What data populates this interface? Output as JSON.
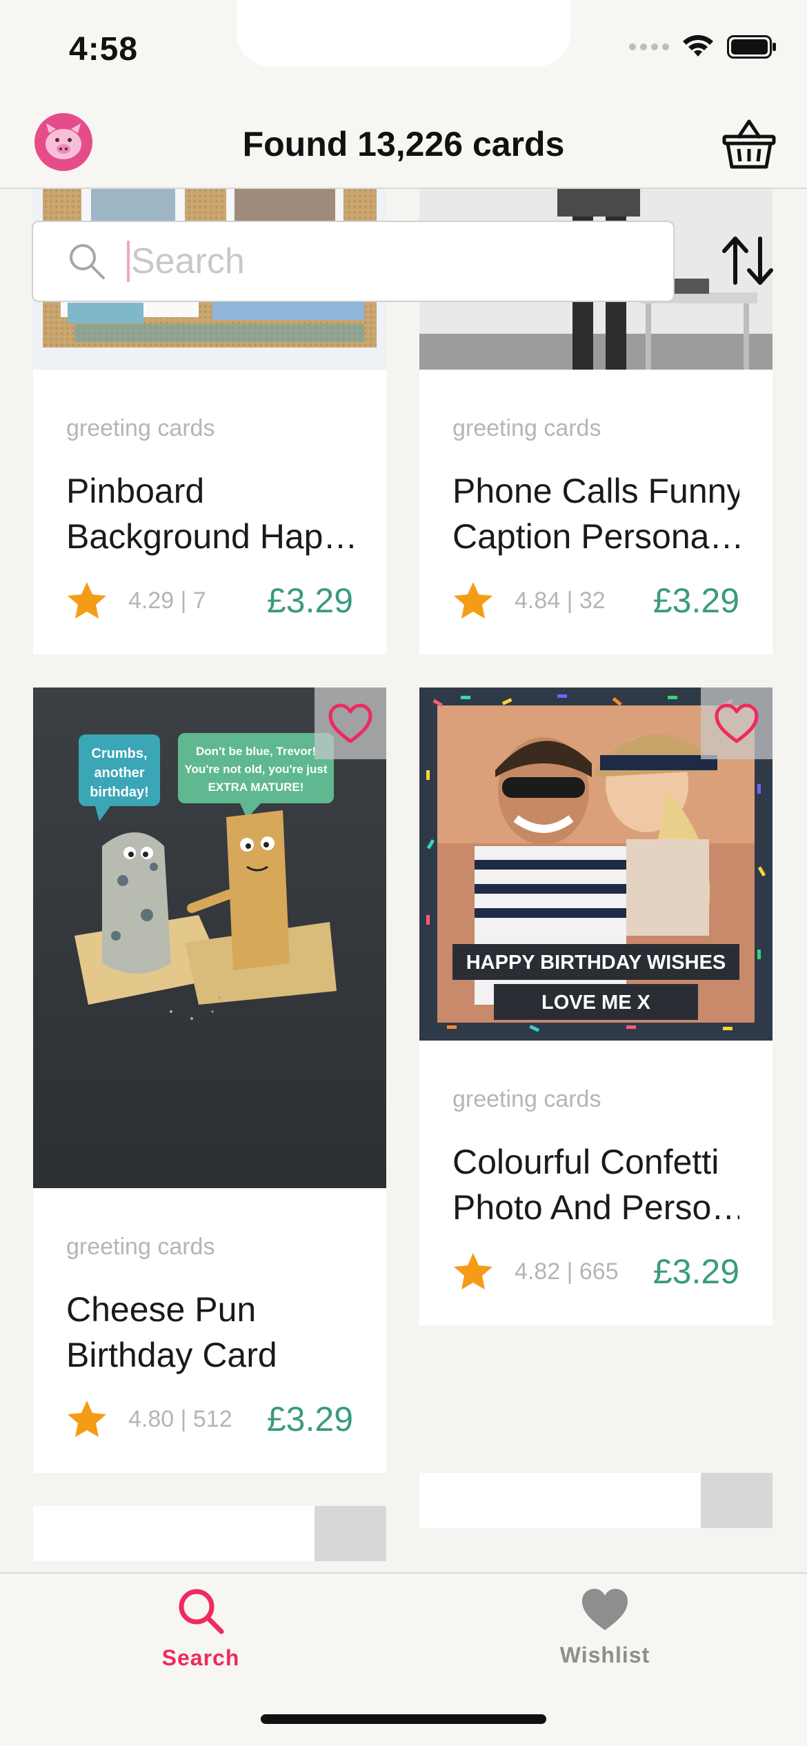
{
  "status_bar": {
    "time": "4:58"
  },
  "header": {
    "title": "Found 13,226 cards",
    "logo_icon": "pig-logo-icon",
    "basket_icon": "basket-icon"
  },
  "search": {
    "placeholder": "Search",
    "value": ""
  },
  "sort_icon": "sort-arrows-icon",
  "colors": {
    "accent_pink": "#ee2a5e",
    "price_green": "#3a9a80",
    "star_orange": "#f59c16",
    "muted_gray": "#8e8e8e"
  },
  "cards": [
    {
      "category": "greeting cards",
      "title": "Pinboard Background Hap…",
      "title_line1": "Pinboard",
      "title_line2": "Background Hap…",
      "rating": "4.29 | 7",
      "price": "£3.29"
    },
    {
      "category": "greeting cards",
      "title_line1": "Phone Calls Funny",
      "title_line2": "Caption Persona…",
      "rating": "4.84 | 32",
      "price": "£3.29"
    },
    {
      "category": "greeting cards",
      "title_line1": "Cheese Pun",
      "title_line2": "Birthday Card",
      "rating": "4.80 | 512",
      "price": "£3.29",
      "image_text": {
        "bubble_left": [
          "Crumbs,",
          "another",
          "birthday!"
        ],
        "bubble_right": [
          "Don't be blue, Trevor!",
          "You're not old, you're just",
          "EXTRA MATURE!"
        ]
      }
    },
    {
      "category": "greeting cards",
      "title_line1": "Colourful Confetti",
      "title_line2": "Photo And Perso…",
      "rating": "4.82 | 665",
      "price": "£3.29",
      "image_text": {
        "banner1": "HAPPY BIRTHDAY WISHES",
        "banner2": "LOVE ME X"
      }
    }
  ],
  "tab_bar": {
    "tabs": [
      {
        "label": "Search",
        "icon": "search-icon",
        "active": true
      },
      {
        "label": "Wishlist",
        "icon": "heart-icon",
        "active": false
      }
    ]
  }
}
